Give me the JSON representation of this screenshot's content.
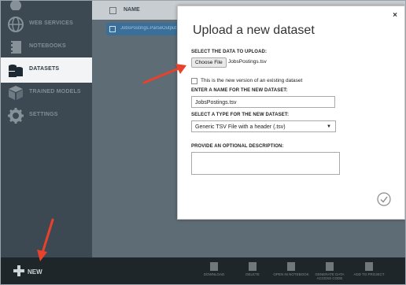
{
  "sidebar": {
    "items": [
      {
        "label": "",
        "icon": "cloud-icon"
      },
      {
        "label": "WEB SERVICES",
        "icon": "globe-icon"
      },
      {
        "label": "NOTEBOOKS",
        "icon": "notebook-icon"
      },
      {
        "label": "DATASETS",
        "icon": "datasets-icon"
      },
      {
        "label": "TRAINED MODELS",
        "icon": "cube-icon"
      },
      {
        "label": "SETTINGS",
        "icon": "gear-icon"
      }
    ]
  },
  "table": {
    "header_name": "NAME",
    "selected_row": "JobsPostings.ParseOutput"
  },
  "bottombar": {
    "new_label": "NEW",
    "tools": [
      "DOWNLOAD",
      "DELETE",
      "OPEN IN NOTEBOOK",
      "GENERATE DATA ACCESS CODE",
      "ADD TO PROJECT"
    ]
  },
  "modal": {
    "close": "×",
    "title": "Upload a new dataset",
    "select_label": "SELECT THE DATA TO UPLOAD:",
    "choose_file": "Choose File",
    "file_name": "JobsPostings.tsv",
    "checkbox_label": "This is the new version of an existing dataset",
    "name_label": "ENTER A NAME FOR THE NEW DATASET:",
    "name_value": "JobsPostings.tsv",
    "type_label": "SELECT A TYPE FOR THE NEW DATASET:",
    "type_value": "Generic TSV File with a header (.tsv)",
    "desc_label": "PROVIDE AN OPTIONAL DESCRIPTION:",
    "desc_value": ""
  },
  "colors": {
    "annotation_arrow": "#e8412c",
    "sidebar_bg": "#3c4953",
    "bottombar_bg": "#1f2629"
  }
}
